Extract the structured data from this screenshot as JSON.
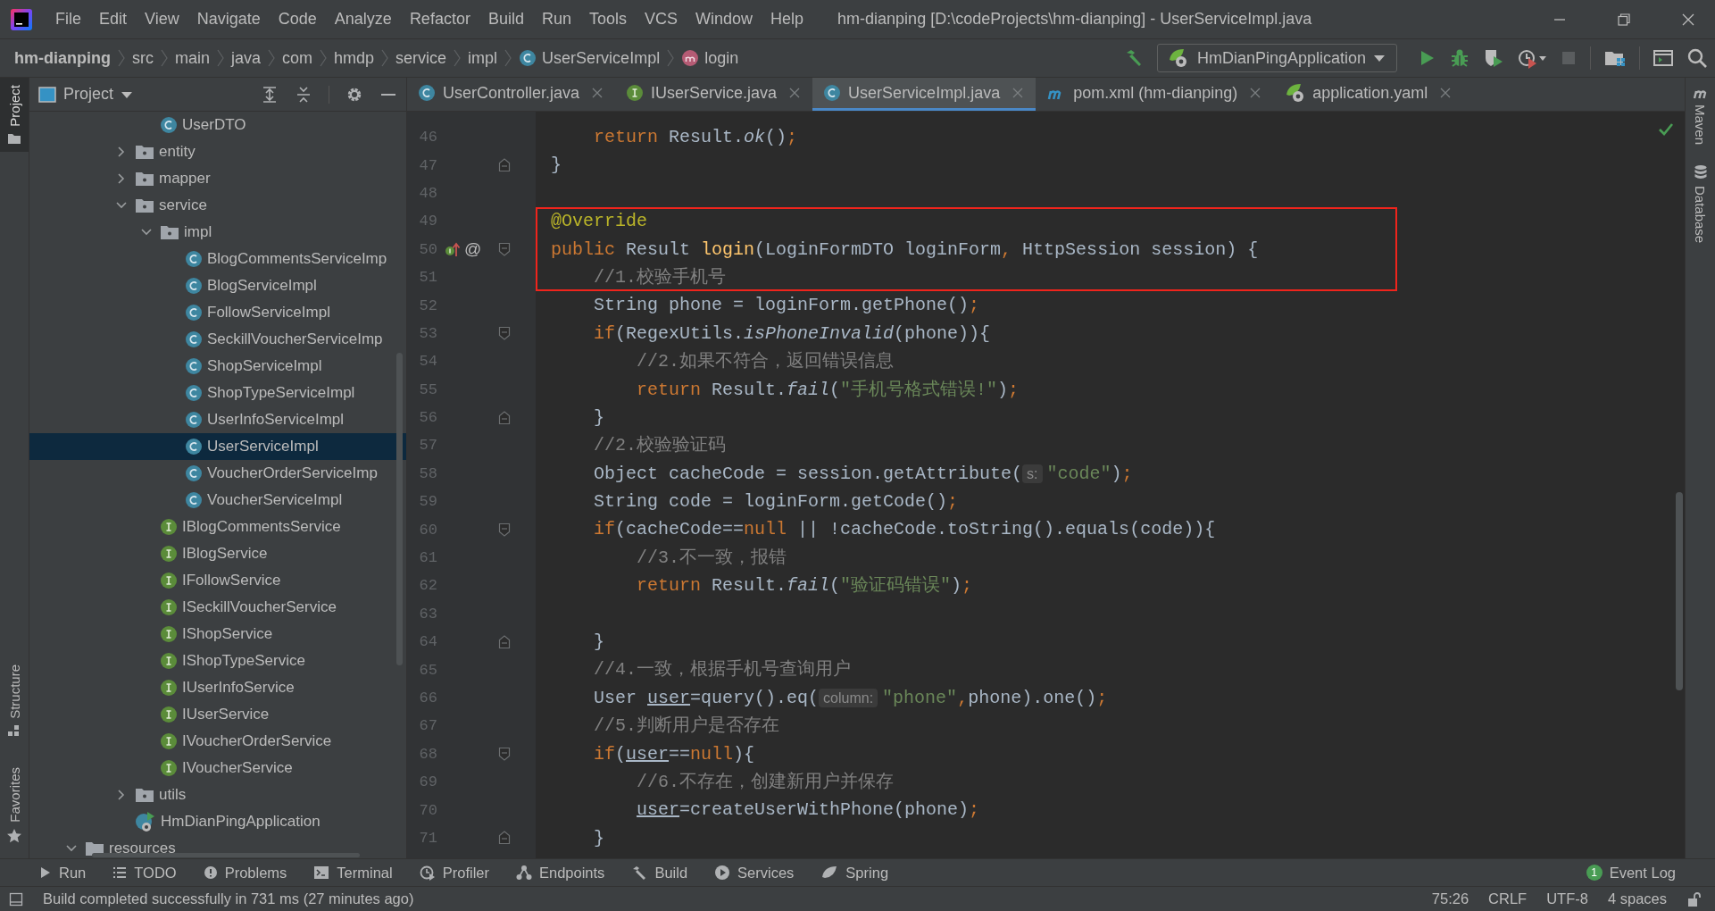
{
  "window": {
    "title": "hm-dianping [D:\\codeProjects\\hm-dianping] - UserServiceImpl.java"
  },
  "menu": [
    "File",
    "Edit",
    "View",
    "Navigate",
    "Code",
    "Analyze",
    "Refactor",
    "Build",
    "Run",
    "Tools",
    "VCS",
    "Window",
    "Help"
  ],
  "breadcrumbs": [
    {
      "label": "hm-dianping",
      "kind": "project"
    },
    {
      "label": "src",
      "kind": "folder"
    },
    {
      "label": "main",
      "kind": "folder"
    },
    {
      "label": "java",
      "kind": "folder"
    },
    {
      "label": "com",
      "kind": "folder"
    },
    {
      "label": "hmdp",
      "kind": "folder"
    },
    {
      "label": "service",
      "kind": "folder"
    },
    {
      "label": "impl",
      "kind": "folder"
    },
    {
      "label": "UserServiceImpl",
      "kind": "class"
    },
    {
      "label": "login",
      "kind": "method"
    }
  ],
  "toolbar": {
    "run_configuration": "HmDianPingApplication"
  },
  "left_stripe": {
    "top": [
      {
        "label": "Project",
        "selected": true,
        "kind": "project"
      }
    ],
    "bottom": [
      {
        "label": "Structure",
        "selected": false,
        "kind": "structure"
      },
      {
        "label": "Favorites",
        "selected": false,
        "kind": "favorites"
      }
    ]
  },
  "project": {
    "title": "Project",
    "tree": [
      {
        "children": [
          {
            "children": [
              {
                "children": [
                  {
                    "label": "UserDTO",
                    "kind": "class",
                    "selected": false
                  }
                ]
              },
              {
                "label": "entity",
                "kind": "package",
                "expanded": false,
                "selected": false
              },
              {
                "label": "mapper",
                "kind": "package",
                "expanded": false,
                "selected": false
              },
              {
                "label": "service",
                "kind": "package",
                "expanded": true,
                "selected": false,
                "children": [
                  {
                    "label": "impl",
                    "kind": "package",
                    "expanded": true,
                    "selected": false,
                    "children": [
                      {
                        "label": "BlogCommentsServiceImp",
                        "kind": "class",
                        "selected": false
                      },
                      {
                        "label": "BlogServiceImpl",
                        "kind": "class",
                        "selected": false
                      },
                      {
                        "label": "FollowServiceImpl",
                        "kind": "class",
                        "selected": false
                      },
                      {
                        "label": "SeckillVoucherServiceImp",
                        "kind": "class",
                        "selected": false
                      },
                      {
                        "label": "ShopServiceImpl",
                        "kind": "class",
                        "selected": false
                      },
                      {
                        "label": "ShopTypeServiceImpl",
                        "kind": "class",
                        "selected": false
                      },
                      {
                        "label": "UserInfoServiceImpl",
                        "kind": "class",
                        "selected": false
                      },
                      {
                        "label": "UserServiceImpl",
                        "kind": "class",
                        "selected": true
                      },
                      {
                        "label": "VoucherOrderServiceImp",
                        "kind": "class",
                        "selected": false
                      },
                      {
                        "label": "VoucherServiceImpl",
                        "kind": "class",
                        "selected": false
                      }
                    ]
                  },
                  {
                    "label": "IBlogCommentsService",
                    "kind": "interface",
                    "selected": false
                  },
                  {
                    "label": "IBlogService",
                    "kind": "interface",
                    "selected": false
                  },
                  {
                    "label": "IFollowService",
                    "kind": "interface",
                    "selected": false
                  },
                  {
                    "label": "ISeckillVoucherService",
                    "kind": "interface",
                    "selected": false
                  },
                  {
                    "label": "IShopService",
                    "kind": "interface",
                    "selected": false
                  },
                  {
                    "label": "IShopTypeService",
                    "kind": "interface",
                    "selected": false
                  },
                  {
                    "label": "IUserInfoService",
                    "kind": "interface",
                    "selected": false
                  },
                  {
                    "label": "IUserService",
                    "kind": "interface",
                    "selected": false
                  },
                  {
                    "label": "IVoucherOrderService",
                    "kind": "interface",
                    "selected": false
                  },
                  {
                    "label": "IVoucherService",
                    "kind": "interface",
                    "selected": false
                  }
                ]
              },
              {
                "label": "utils",
                "kind": "package",
                "expanded": false,
                "selected": false
              },
              {
                "label": "HmDianPingApplication",
                "kind": "spring-app",
                "selected": false
              }
            ]
          }
        ]
      },
      {
        "label": "resources",
        "kind": "folder",
        "expanded": true,
        "selected": false
      }
    ]
  },
  "tabs": [
    {
      "label": "UserController.java",
      "kind": "class",
      "selected": false
    },
    {
      "label": "IUserService.java",
      "kind": "interface",
      "selected": false
    },
    {
      "label": "UserServiceImpl.java",
      "kind": "class",
      "selected": true
    },
    {
      "label": "pom.xml (hm-dianping)",
      "kind": "maven",
      "selected": false
    },
    {
      "label": "application.yaml",
      "kind": "spring",
      "selected": false
    }
  ],
  "editor": {
    "lines": [
      {
        "number": "46",
        "tokens": [
          {
            "kind": "kw",
            "text": "    return"
          },
          {
            "kind": "txt",
            "text": " Result."
          },
          {
            "kind": "static",
            "text": "ok"
          },
          {
            "kind": "txt",
            "text": "()"
          },
          {
            "kind": "op",
            "text": ";"
          }
        ]
      },
      {
        "number": "47",
        "fold_end": true,
        "tokens": [
          {
            "kind": "txt",
            "text": "}"
          }
        ]
      },
      {
        "number": "48"
      },
      {
        "number": "49",
        "highlighted": true,
        "tokens": [
          {
            "kind": "ann",
            "text": "@Override"
          }
        ]
      },
      {
        "number": "50",
        "highlighted": true,
        "implements": true,
        "gutter_text": "@",
        "fold_start": true,
        "tokens": [
          {
            "kind": "kw",
            "text": "public"
          },
          {
            "kind": "txt",
            "text": " Result "
          },
          {
            "kind": "fn",
            "text": "login"
          },
          {
            "kind": "txt",
            "text": "(LoginFormDTO loginForm"
          },
          {
            "kind": "op",
            "text": ","
          },
          {
            "kind": "txt",
            "text": " HttpSession session) {"
          }
        ]
      },
      {
        "number": "51",
        "highlighted": true,
        "tokens": [
          {
            "kind": "cmt",
            "text": "    //1.校验手机号"
          }
        ]
      },
      {
        "number": "52",
        "tokens": [
          {
            "kind": "txt",
            "text": "    String phone = loginForm.getPhone()"
          },
          {
            "kind": "op",
            "text": ";"
          }
        ]
      },
      {
        "number": "53",
        "fold_start": true,
        "tokens": [
          {
            "kind": "kw",
            "text": "    if"
          },
          {
            "kind": "txt",
            "text": "(RegexUtils."
          },
          {
            "kind": "static",
            "text": "isPhoneInvalid"
          },
          {
            "kind": "txt",
            "text": "(phone)){"
          }
        ]
      },
      {
        "number": "54",
        "tokens": [
          {
            "kind": "cmt",
            "text": "        //2.如果不符合，返回错误信息"
          }
        ]
      },
      {
        "number": "55",
        "tokens": [
          {
            "kind": "kw",
            "text": "        return"
          },
          {
            "kind": "txt",
            "text": " Result."
          },
          {
            "kind": "static",
            "text": "fail"
          },
          {
            "kind": "txt",
            "text": "("
          },
          {
            "kind": "str",
            "text": "\"手机号格式错误!\""
          },
          {
            "kind": "txt",
            "text": ")"
          },
          {
            "kind": "op",
            "text": ";"
          }
        ]
      },
      {
        "number": "56",
        "fold_end": true,
        "tokens": [
          {
            "kind": "txt",
            "text": "    }"
          }
        ]
      },
      {
        "number": "57",
        "tokens": [
          {
            "kind": "cmt",
            "text": "    //2.校验验证码"
          }
        ]
      },
      {
        "number": "58",
        "tokens": [
          {
            "kind": "txt",
            "text": "    Object cacheCode = session.getAttribute("
          },
          {
            "kind": "hint",
            "text": "s:"
          },
          {
            "kind": "str",
            "text": "\"code\""
          },
          {
            "kind": "txt",
            "text": ")"
          },
          {
            "kind": "op",
            "text": ";"
          }
        ]
      },
      {
        "number": "59",
        "tokens": [
          {
            "kind": "txt",
            "text": "    String code = loginForm.getCode()"
          },
          {
            "kind": "op",
            "text": ";"
          }
        ]
      },
      {
        "number": "60",
        "fold_start": true,
        "tokens": [
          {
            "kind": "kw",
            "text": "    if"
          },
          {
            "kind": "txt",
            "text": "(cacheCode=="
          },
          {
            "kind": "kw",
            "text": "null"
          },
          {
            "kind": "txt",
            "text": " || !cacheCode.toString().equals(code)){"
          }
        ]
      },
      {
        "number": "61",
        "tokens": [
          {
            "kind": "cmt",
            "text": "        //3.不一致，报错"
          }
        ]
      },
      {
        "number": "62",
        "tokens": [
          {
            "kind": "kw",
            "text": "        return"
          },
          {
            "kind": "txt",
            "text": " Result."
          },
          {
            "kind": "static",
            "text": "fail"
          },
          {
            "kind": "txt",
            "text": "("
          },
          {
            "kind": "str",
            "text": "\"验证码错误\""
          },
          {
            "kind": "txt",
            "text": ")"
          },
          {
            "kind": "op",
            "text": ";"
          }
        ]
      },
      {
        "number": "63"
      },
      {
        "number": "64",
        "fold_end": true,
        "tokens": [
          {
            "kind": "txt",
            "text": "    }"
          }
        ]
      },
      {
        "number": "65",
        "tokens": [
          {
            "kind": "cmt",
            "text": "    //4.一致，根据手机号查询用户"
          }
        ]
      },
      {
        "number": "66",
        "tokens": [
          {
            "kind": "txt",
            "text": "    User "
          },
          {
            "kind": "var",
            "text": "user"
          },
          {
            "kind": "txt",
            "text": "=query().eq("
          },
          {
            "kind": "hint",
            "text": "column:"
          },
          {
            "kind": "str",
            "text": "\"phone\""
          },
          {
            "kind": "op",
            "text": ","
          },
          {
            "kind": "txt",
            "text": "phone).one()"
          },
          {
            "kind": "op",
            "text": ";"
          }
        ]
      },
      {
        "number": "67",
        "tokens": [
          {
            "kind": "cmt",
            "text": "    //5.判断用户是否存在"
          }
        ]
      },
      {
        "number": "68",
        "fold_start": true,
        "tokens": [
          {
            "kind": "kw",
            "text": "    if"
          },
          {
            "kind": "txt",
            "text": "("
          },
          {
            "kind": "var",
            "text": "user"
          },
          {
            "kind": "txt",
            "text": "=="
          },
          {
            "kind": "kw",
            "text": "null"
          },
          {
            "kind": "txt",
            "text": "){"
          }
        ]
      },
      {
        "number": "69",
        "tokens": [
          {
            "kind": "cmt",
            "text": "        //6.不存在，创建新用户并保存"
          }
        ]
      },
      {
        "number": "70",
        "tokens": [
          {
            "kind": "var",
            "text": "        user"
          },
          {
            "kind": "txt",
            "text": "=createUserWithPhone(phone)"
          },
          {
            "kind": "op",
            "text": ";"
          }
        ]
      },
      {
        "number": "71",
        "fold_end": true,
        "tokens": [
          {
            "kind": "txt",
            "text": "    }"
          }
        ]
      }
    ]
  },
  "right_stripe": [
    {
      "label": "Maven",
      "kind": "maven"
    },
    {
      "label": "Database",
      "kind": "database"
    }
  ],
  "tool_windows": [
    {
      "label": "Run",
      "kind": "run"
    },
    {
      "label": "TODO",
      "kind": "todo"
    },
    {
      "label": "Problems",
      "kind": "problems"
    },
    {
      "label": "Terminal",
      "kind": "terminal"
    },
    {
      "label": "Profiler",
      "kind": "profiler"
    },
    {
      "label": "Endpoints",
      "kind": "endpoints"
    },
    {
      "label": "Build",
      "kind": "build"
    },
    {
      "label": "Services",
      "kind": "services"
    },
    {
      "label": "Spring",
      "kind": "spring"
    }
  ],
  "event_log": {
    "label": "Event Log",
    "count": "1"
  },
  "status_bar": {
    "message": "Build completed successfully in 731 ms (27 minutes ago)",
    "position": "75:26",
    "line_separator": "CRLF",
    "encoding": "UTF-8",
    "indent": "4 spaces"
  }
}
